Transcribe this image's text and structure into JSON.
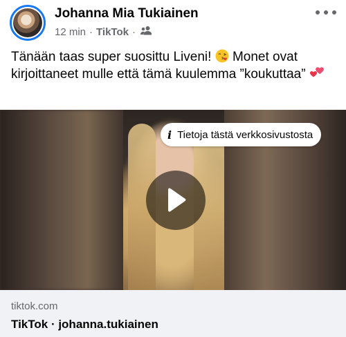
{
  "post": {
    "author": "Johanna Mia Tukiainen",
    "time": "12 min",
    "separator": "·",
    "source": "TikTok",
    "audience_icon": "friends-icon",
    "more_icon": "more-options-icon",
    "text_part1": "Tänään taas super suosittu Liveni!",
    "emoji1": "face-blowing-kiss-emoji",
    "text_part2": "Monet ovat kirjoittaneet mulle että tämä kuulemma ”koukuttaa”",
    "emoji2": "two-hearts-emoji"
  },
  "media": {
    "info_icon": "i",
    "info_label": "Tietoja tästä verkkosivustosta",
    "play_icon": "play-icon"
  },
  "link": {
    "domain": "tiktok.com",
    "title": "TikTok · johanna.tukiainen"
  },
  "colors": {
    "accent": "#1877f2",
    "secondary_text": "#65676b",
    "link_background": "#f0f2f5"
  }
}
